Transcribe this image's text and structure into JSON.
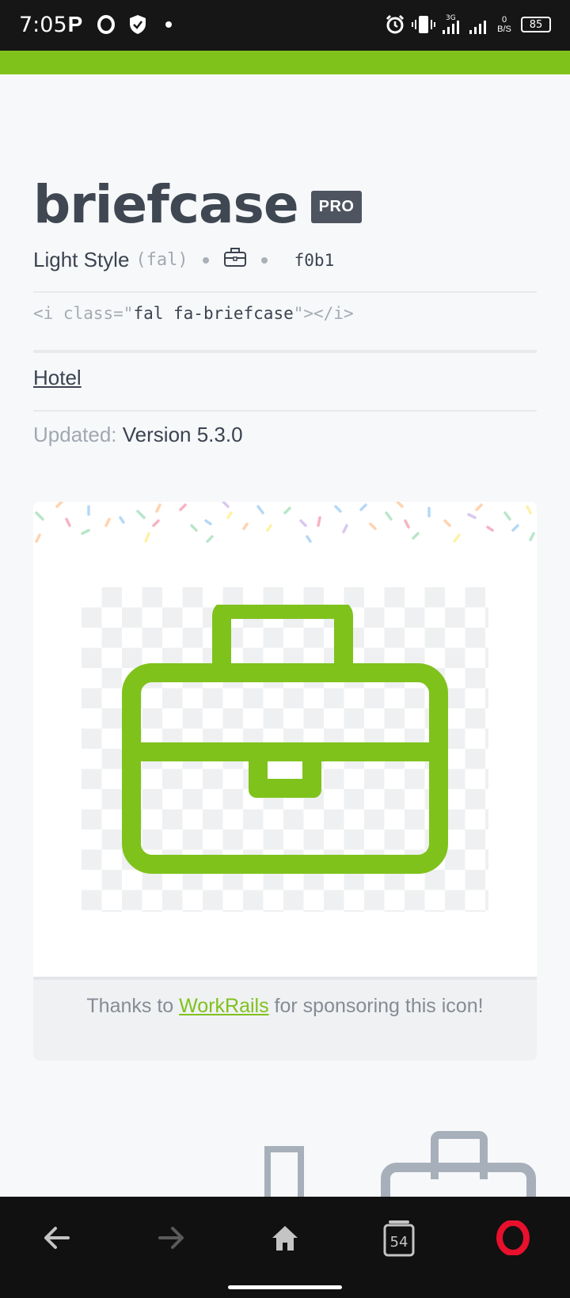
{
  "status_bar": {
    "time": "7:05",
    "net_speed_top": "0",
    "net_speed_bottom": "B/S",
    "network_type": "3G",
    "battery": "85"
  },
  "icon": {
    "name": "briefcase",
    "badge": "PRO",
    "style_label": "Light Style",
    "style_code": "(fal)",
    "unicode": "f0b1",
    "snippet_open": "<i class=\"",
    "snippet_class": "fal fa-briefcase",
    "snippet_close": "\"></i>",
    "category_link": "Hotel",
    "updated_label": "Updated:",
    "updated_value": "Version 5.3.0",
    "color": "#7fc21c"
  },
  "sponsor": {
    "prefix": "Thanks to ",
    "link": "WorkRails",
    "suffix": " for sponsoring this icon!"
  },
  "nav": {
    "tab_count": "54"
  }
}
